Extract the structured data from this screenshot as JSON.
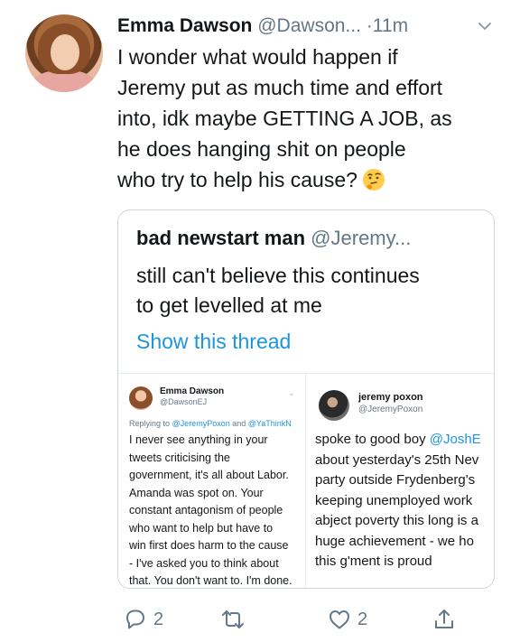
{
  "tweet": {
    "author_name": "Emma Dawson",
    "author_handle": "@Dawson...",
    "separator": "·",
    "time": "11m",
    "text_lines": [
      "I wonder what would happen if",
      "Jeremy put as much time and effort",
      "into, idk maybe GETTING A JOB, as",
      "he does hanging shit on people",
      "who try to help his cause?"
    ],
    "emoji": "thinking-face"
  },
  "quote": {
    "author_name": "bad newstart man",
    "author_handle": "@Jeremy...",
    "text_lines": [
      "still can't believe this continues",
      "to get levelled at me"
    ],
    "show_thread": "Show this thread"
  },
  "screenshot_left": {
    "name": "Emma Dawson",
    "handle": "@DawsonEJ",
    "reply_prefix": "Replying to",
    "reply_mention_1": "@JeremyPoxon",
    "reply_and": "and",
    "reply_mention_2": "@YaThinkN",
    "text_lines": [
      "I never see anything in your",
      "tweets criticising the",
      "government, it's all about Labor.",
      "Amanda was spot on. Your",
      "constant antagonism of people",
      "who want to help but have to",
      "win first does harm to the cause",
      "- I've asked you to think about",
      "that. You don't want to. I'm done."
    ]
  },
  "screenshot_right": {
    "name": "jeremy poxon",
    "handle": "@JeremyPoxon",
    "line1_prefix": "spoke to good boy",
    "line1_mention": "@JoshE",
    "text_lines": [
      "about yesterday's 25th Nev",
      "party outside Frydenberg's",
      "keeping unemployed work",
      "abject poverty this long is a",
      "huge achievement - we ho",
      "this g'ment is proud"
    ]
  },
  "actions": {
    "reply_count": "2",
    "retweet_count": "",
    "like_count": "2",
    "icons": [
      "reply-icon",
      "retweet-icon",
      "like-icon",
      "share-icon"
    ]
  },
  "colors": {
    "link": "#1b95e0",
    "muted": "#657786",
    "border": "#ccd6dd"
  }
}
